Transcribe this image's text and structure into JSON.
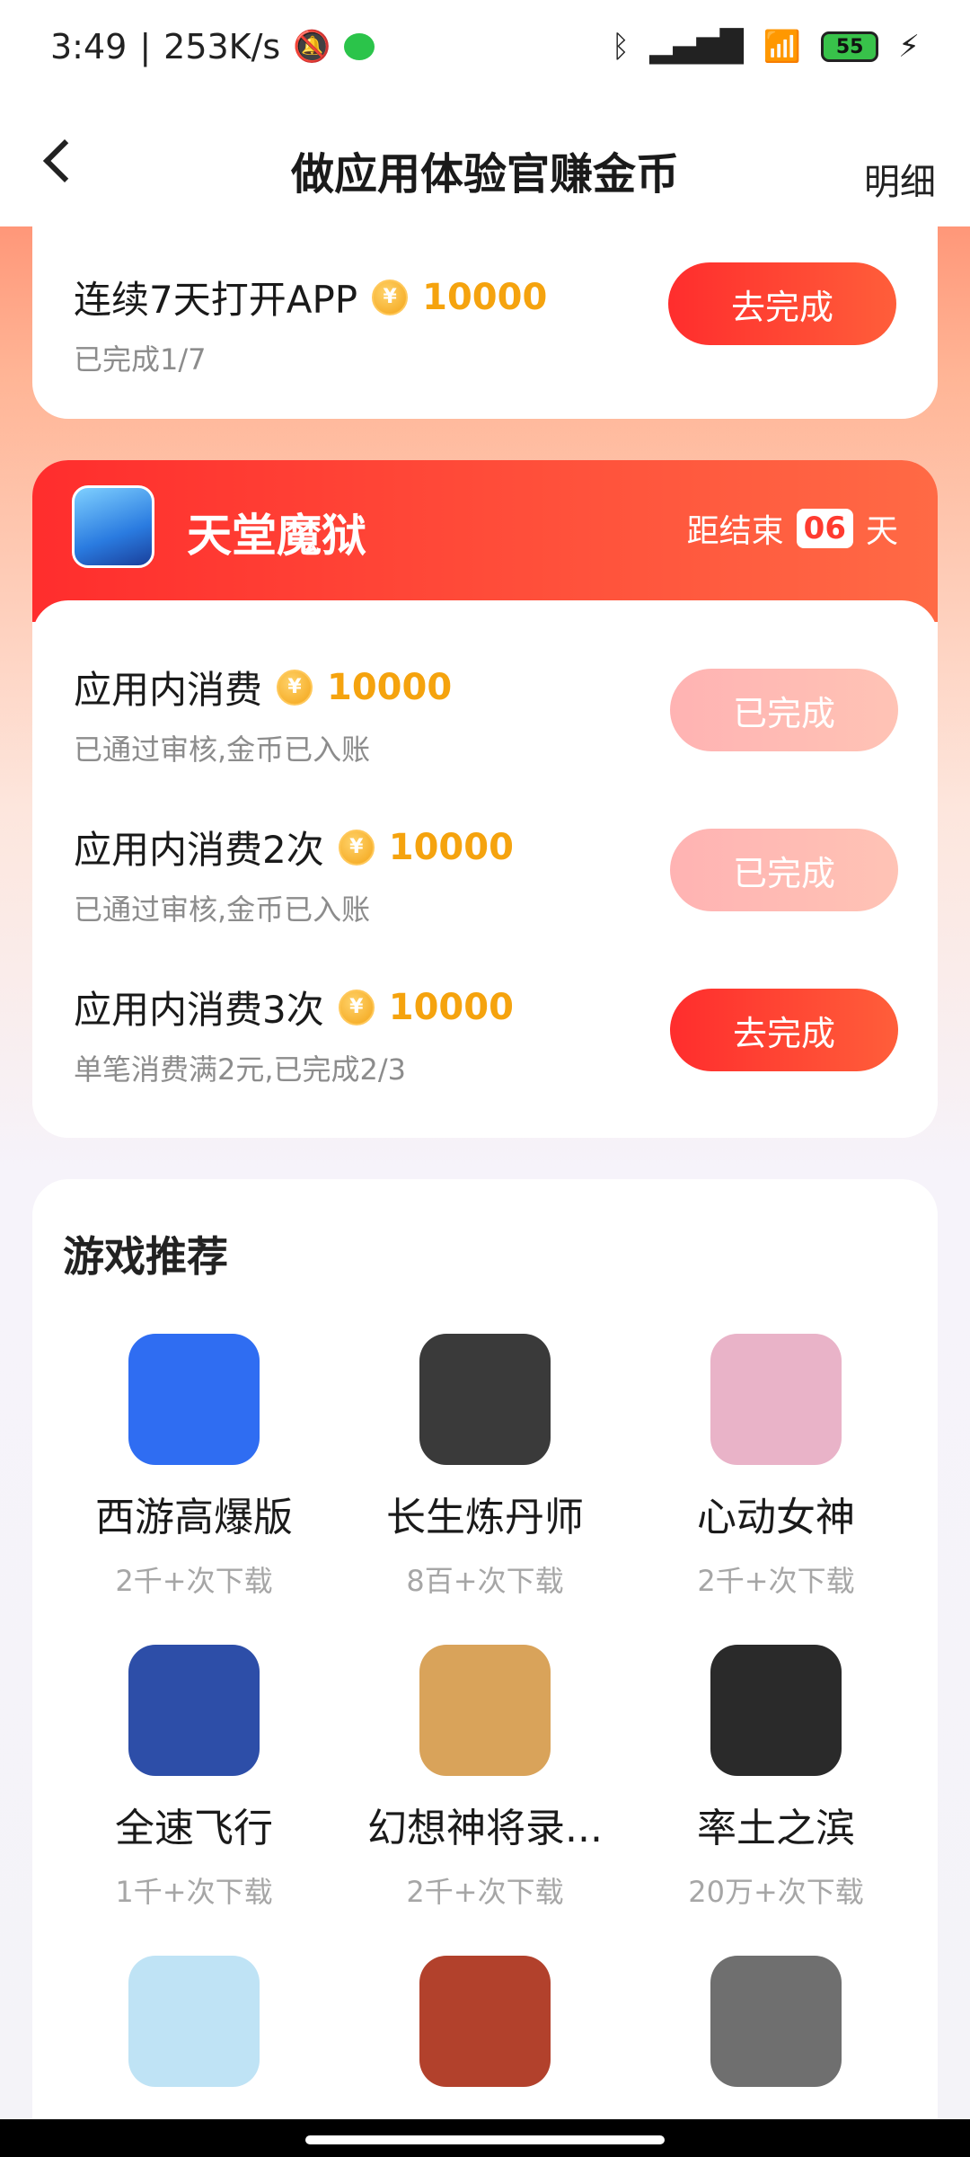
{
  "status": {
    "time": "3:49",
    "speed": "253K/s",
    "battery": "55"
  },
  "header": {
    "title": "做应用体验官赚金币",
    "detail": "明细"
  },
  "card1": {
    "title": "连续7天打开APP",
    "reward": "10000",
    "subtitle": "已完成1/7",
    "button": "去完成"
  },
  "card2": {
    "app_name": "天堂魔狱",
    "countdown_prefix": "距结束",
    "countdown_value": "06",
    "countdown_unit": "天",
    "tasks": [
      {
        "title": "应用内消费",
        "reward": "10000",
        "subtitle": "已通过审核,金币已入账",
        "button": "已完成"
      },
      {
        "title": "应用内消费2次",
        "reward": "10000",
        "subtitle": "已通过审核,金币已入账",
        "button": "已完成"
      },
      {
        "title": "应用内消费3次",
        "reward": "10000",
        "subtitle": "单笔消费满2元,已完成2/3",
        "button": "去完成"
      }
    ]
  },
  "recommendations": {
    "title": "游戏推荐",
    "games": [
      {
        "name": "西游高爆版",
        "downloads": "2千+次下载",
        "color": "#2f6df2"
      },
      {
        "name": "长生炼丹师",
        "downloads": "8百+次下载",
        "color": "#3a3a3a"
      },
      {
        "name": "心动女神",
        "downloads": "2千+次下载",
        "color": "#e9b3c8"
      },
      {
        "name": "全速飞行",
        "downloads": "1千+次下载",
        "color": "#2d4ea8"
      },
      {
        "name": "幻想神将录...",
        "downloads": "2千+次下载",
        "color": "#d9a35a"
      },
      {
        "name": "率土之滨",
        "downloads": "20万+次下载",
        "color": "#2a2a2a"
      },
      {
        "name": "",
        "downloads": "",
        "color": "#bfe3f5"
      },
      {
        "name": "",
        "downloads": "",
        "color": "#b2412c"
      },
      {
        "name": "",
        "downloads": "",
        "color": "#6f6f6f"
      }
    ]
  },
  "coin_symbol": "¥"
}
